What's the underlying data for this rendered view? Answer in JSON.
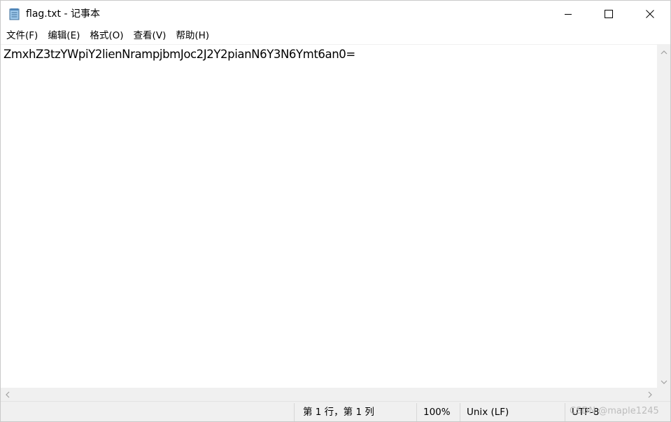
{
  "window": {
    "title": "flag.txt - 记事本"
  },
  "icons": {
    "app": "notepad-icon",
    "minimize": "minimize-icon",
    "maximize": "maximize-icon",
    "close": "close-icon"
  },
  "menu": {
    "file": "文件(F)",
    "edit": "编辑(E)",
    "format": "格式(O)",
    "view": "查看(V)",
    "help": "帮助(H)"
  },
  "editor": {
    "content": "ZmxhZ3tzYWpiY2lienNrampjbmJoc2J2Y2pianN6Y3N6Ymt6an0="
  },
  "status": {
    "position": "第 1 行，第 1 列",
    "zoom": "100%",
    "line_ending": "Unix (LF)",
    "encoding": "UTF-8",
    "watermark": "CSDN @maple1245"
  }
}
